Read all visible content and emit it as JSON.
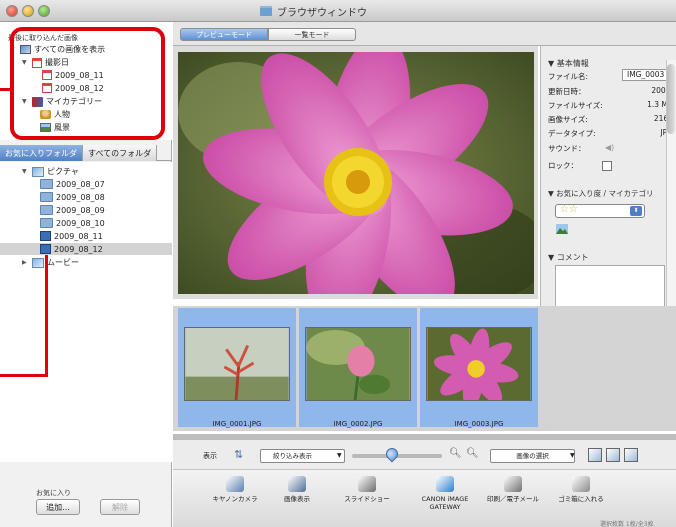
{
  "window": {
    "title": "ブラウザウィンドウ"
  },
  "sidebar": {
    "recent_header": "最後に取り込んだ画像",
    "recent_tree": [
      {
        "label": "すべての画像を表示"
      },
      {
        "label": "撮影日"
      },
      {
        "label": "2009_08_11"
      },
      {
        "label": "2009_08_12"
      },
      {
        "label": "マイカテゴリー"
      },
      {
        "label": "人物"
      },
      {
        "label": "風景"
      }
    ],
    "tabs": [
      "お気に入りフォルダ",
      "すべてのフォルダ"
    ],
    "folder_tree": [
      {
        "label": "ピクチャ"
      },
      {
        "label": "2009_08_07"
      },
      {
        "label": "2009_08_08"
      },
      {
        "label": "2009_08_09"
      },
      {
        "label": "2009_08_10"
      },
      {
        "label": "2009_08_11"
      },
      {
        "label": "2009_08_12"
      },
      {
        "label": "ムービー"
      }
    ],
    "favorites_label": "お気に入り",
    "add_button": "追加...",
    "remove_button": "解除"
  },
  "modes": {
    "preview": "プレビューモード",
    "list": "一覧モード"
  },
  "info": {
    "basic_header": "▼ 基本情報",
    "fields": [
      {
        "label": "ファイル名:",
        "value": "IMG_0003"
      },
      {
        "label": "更新日時：",
        "value": "2009/"
      },
      {
        "label": "ファイルサイズ:",
        "value": "1.3 MB"
      },
      {
        "label": "画像サイズ:",
        "value": "2160"
      },
      {
        "label": "データタイプ:",
        "value": "JPG"
      },
      {
        "label": "サウンド：",
        "value": ""
      },
      {
        "label": "ロック：",
        "value": ""
      }
    ],
    "rating_header": "▼ お気に入り度 / マイカテゴリ",
    "rating_stars": "☆☆",
    "comment_header": "▼ コメント"
  },
  "thumbnails": [
    {
      "name": "IMG_0001.JPG"
    },
    {
      "name": "IMG_0002.JPG"
    },
    {
      "name": "IMG_0003.JPG"
    }
  ],
  "controls": {
    "display_label": "表示",
    "filter_value": "絞り込み表示",
    "select_images": "画像の選択"
  },
  "actions": [
    {
      "label": "キヤノンカメラ",
      "icon": "camera-icon",
      "color": "#5a7fb0"
    },
    {
      "label": "画像表示",
      "icon": "image-view-icon",
      "color": "#4f6f96"
    },
    {
      "label": "スライドショー",
      "icon": "slideshow-icon",
      "color": "#6c6c6c"
    },
    {
      "label": "CANON iMAGE GATEWAY",
      "icon": "gateway-icon",
      "color": "#2f7fd0"
    },
    {
      "label": "印刷／電子メール",
      "icon": "print-icon",
      "color": "#707070"
    },
    {
      "label": "ゴミ箱に入れる",
      "icon": "trash-icon",
      "color": "#8a8a8a"
    }
  ],
  "status": {
    "text": "選択枚数 1枚/全3枚"
  },
  "colors": {
    "highlight": "#e0000b",
    "selection": "#8fb7ec",
    "accent": "#5f90d3"
  }
}
